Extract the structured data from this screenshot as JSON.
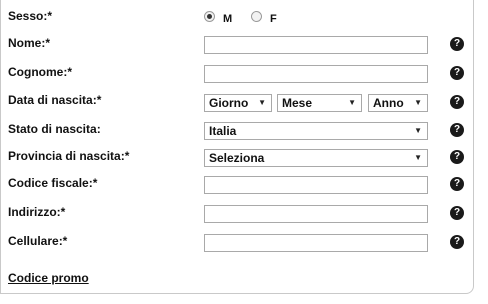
{
  "gender": {
    "label": "Sesso:*",
    "options": [
      {
        "label": "M",
        "checked": true
      },
      {
        "label": "F",
        "checked": false
      }
    ]
  },
  "fields": {
    "nome": {
      "label": "Nome:*",
      "value": ""
    },
    "cognome": {
      "label": "Cognome:*",
      "value": ""
    },
    "data_nascita": {
      "label": "Data di nascita:*",
      "giorno": "Giorno",
      "mese": "Mese",
      "anno": "Anno"
    },
    "stato_nascita": {
      "label": "Stato di nascita:",
      "value": "Italia"
    },
    "provincia_nascita": {
      "label": "Provincia di nascita:*",
      "value": "Seleziona"
    },
    "codice_fiscale": {
      "label": "Codice fiscale:*",
      "value": ""
    },
    "indirizzo": {
      "label": "Indirizzo:*",
      "value": ""
    },
    "cellulare": {
      "label": "Cellulare:*",
      "value": ""
    }
  },
  "help_glyph": "?",
  "dropdown_arrow": "▼",
  "promo_link": "Codice promo"
}
